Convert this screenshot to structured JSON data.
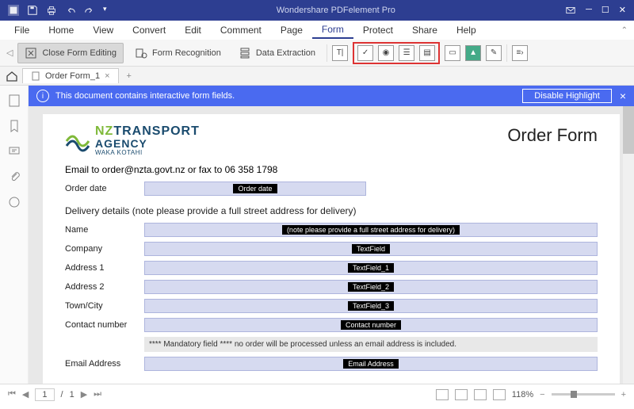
{
  "titlebar": {
    "app_title": "Wondershare PDFelement Pro"
  },
  "menu": {
    "items": [
      "File",
      "Home",
      "View",
      "Convert",
      "Edit",
      "Comment",
      "Page",
      "Form",
      "Protect",
      "Share",
      "Help"
    ],
    "active": "Form"
  },
  "ribbon": {
    "close_form": "Close Form Editing",
    "form_recog": "Form Recognition",
    "data_extract": "Data Extraction"
  },
  "tabs": {
    "doc_name": "Order Form_1"
  },
  "banner": {
    "text": "This document contains interactive form fields.",
    "btn": "Disable Highlight"
  },
  "doc": {
    "logo": {
      "nz": "NZ",
      "transport": "TRANSPORT",
      "agency": "AGENCY",
      "waka": "WAKA KOTAHI"
    },
    "title": "Order Form",
    "email_line": "Email to order@nzta.govt.nz or fax to 06 358 1798",
    "order_date_label": "Order date",
    "order_date_tag": "Order date",
    "delivery_section": "Delivery details (note please provide a full street address for delivery)",
    "fields": [
      {
        "label": "Name",
        "tag": "(note please provide a full street address for delivery)"
      },
      {
        "label": "Company",
        "tag": "TextField"
      },
      {
        "label": "Address 1",
        "tag": "TextField_1"
      },
      {
        "label": "Address 2",
        "tag": "TextField_2"
      },
      {
        "label": "Town/City",
        "tag": "TextField_3"
      },
      {
        "label": "Contact number",
        "tag": "Contact number"
      }
    ],
    "mandatory_note": "**** Mandatory field **** no order will be processed unless an email address is included.",
    "email_label": "Email Address",
    "email_tag": "Email Address"
  },
  "status": {
    "page": "1",
    "total": "1",
    "sep": "/",
    "zoom": "118%"
  }
}
